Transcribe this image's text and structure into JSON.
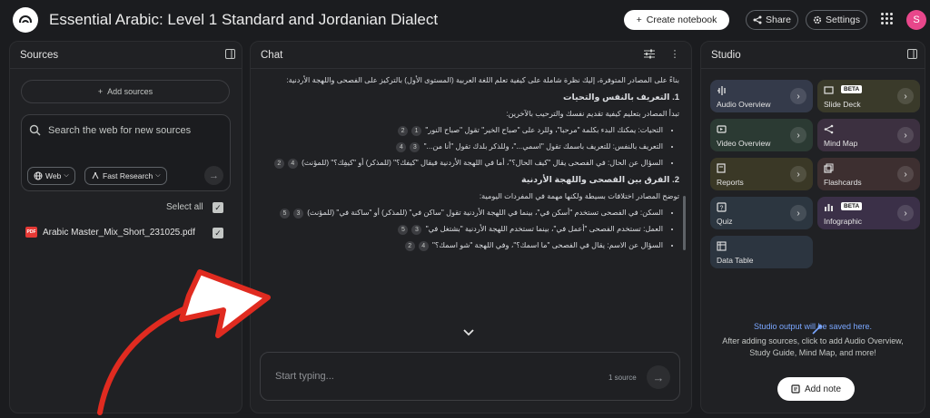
{
  "header": {
    "title": "Essential Arabic: Level 1 Standard and Jordanian Dialect",
    "create_label": "Create notebook",
    "share_label": "Share",
    "settings_label": "Settings",
    "avatar_initial": "S"
  },
  "sources": {
    "title": "Sources",
    "add_label": "Add sources",
    "search_placeholder": "Search the web for new sources",
    "chip_web": "Web",
    "chip_research": "Fast Research",
    "select_all": "Select all",
    "items": [
      {
        "name": "Arabic Master_Mix_Short_231025.pdf",
        "type_badge": "PDF",
        "checked": true
      }
    ]
  },
  "chat": {
    "title": "Chat",
    "intro": "بناءً على المصادر المتوفرة، إليك نظرة شاملة على كيفية تعلم اللغة العربية (المستوى الأول) بالتركيز على الفصحى واللهجة الأردنية:",
    "sections": [
      {
        "heading": "1. التعريف بالنفس والتحيات",
        "lead": "تبدأ المصادر بتعليم كيفية تقديم نفسك والترحيب بالآخرين:",
        "bullets": [
          {
            "text": "التحيات: يمكنك البدء بكلمة \"مرحبا\"، وللرد على \"صباح الخير\" تقول \"صباح النور\"",
            "cites": [
              "1",
              "2"
            ]
          },
          {
            "text": "التعريف بالنفس: للتعريف باسمك تقول \"اسمي...\"، وللذكر بلدك تقول \"أنا من...\"",
            "cites": [
              "3",
              "4"
            ]
          },
          {
            "text": "السؤال عن الحال: في الفصحى يقال \"كيف الحال؟\"، أما في اللهجة الأردنية فيقال \"كيفك؟\" (للمذكر) أو \"كيفِك؟\" (للمؤنث)",
            "cites": [
              "4",
              "2"
            ]
          }
        ]
      },
      {
        "heading": "2. الفرق بين الفصحى واللهجة الأردنية",
        "lead": "توضح المصادر اختلافات بسيطة ولكنها مهمة في المفردات اليومية:",
        "bullets": [
          {
            "text": "السكن: في الفصحى تستخدم \"أسكن في\"، بينما في اللهجة الأردنية تقول \"ساكن في\" (للمذكر) أو \"ساكنة في\" (للمؤنث)",
            "cites": [
              "3",
              "5"
            ]
          },
          {
            "text": "العمل: تستخدم الفصحى \"أعمل في\"، بينما تستخدم اللهجة الأردنية \"بشتغل في\"",
            "cites": [
              "3",
              "5"
            ]
          },
          {
            "text": "السؤال عن الاسم: يقال في الفصحى \"ما اسمك؟\"، وفي اللهجة \"شو اسمك؟\"",
            "cites": [
              "4",
              "2"
            ]
          }
        ]
      }
    ],
    "input_placeholder": "Start typing...",
    "source_count": "1 source"
  },
  "studio": {
    "title": "Studio",
    "tiles": [
      {
        "label": "Audio Overview",
        "icon": "audio-icon",
        "color": "#343a4a",
        "beta": false
      },
      {
        "label": "Slide Deck",
        "icon": "slides-icon",
        "color": "#3a3a2a",
        "beta": true,
        "beta_label": "BETA"
      },
      {
        "label": "Video Overview",
        "icon": "video-icon",
        "color": "#2b3a33",
        "beta": false
      },
      {
        "label": "Mind Map",
        "icon": "mindmap-icon",
        "color": "#3c3040",
        "beta": false
      },
      {
        "label": "Reports",
        "icon": "reports-icon",
        "color": "#3a3826",
        "beta": false
      },
      {
        "label": "Flashcards",
        "icon": "flashcards-icon",
        "color": "#3d2f30",
        "beta": false
      },
      {
        "label": "Quiz",
        "icon": "quiz-icon",
        "color": "#2c3640",
        "beta": false
      },
      {
        "label": "Infographic",
        "icon": "infographic-icon",
        "color": "#3b3048",
        "beta": true,
        "beta_label": "BETA"
      },
      {
        "label": "Data Table",
        "icon": "table-icon",
        "color": "#2c3540",
        "beta": false
      }
    ],
    "empty_title": "Studio output will be saved here.",
    "empty_text": "After adding sources, click to add Audio Overview, Study Guide, Mind Map, and more!",
    "add_note_label": "Add note"
  }
}
